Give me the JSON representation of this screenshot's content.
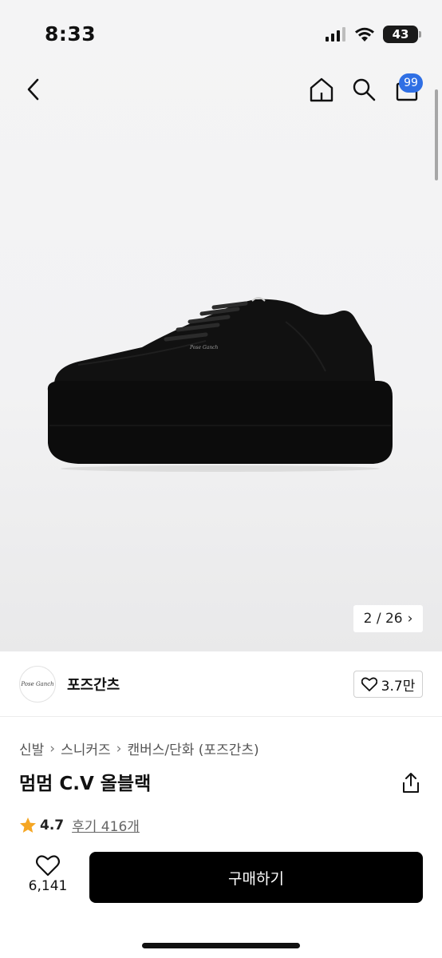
{
  "status_bar": {
    "time": "8:33",
    "battery": "43"
  },
  "nav": {
    "back_icon": "chevron-left-icon",
    "home_icon": "home-icon",
    "search_icon": "search-icon",
    "cart_icon": "cart-icon",
    "cart_badge": "99",
    "badge_color": "#2f6fe4"
  },
  "gallery": {
    "counter": "2 / 26",
    "counter_arrow": "›"
  },
  "brand": {
    "logo_text": "Pose Ganch",
    "name": "포즈간츠",
    "likes": "3.7만"
  },
  "breadcrumb": {
    "items": [
      "신발",
      "스니커즈",
      "캔버스/단화 (포즈간츠)"
    ],
    "separator": "›"
  },
  "product": {
    "title": "멈멈 C.V 올블랙",
    "rating": "4.7",
    "reviews": "후기 416개",
    "star_color": "#f5a623"
  },
  "bottom": {
    "wish_count": "6,141",
    "buy_label": "구매하기",
    "buy_color": "#000000"
  }
}
